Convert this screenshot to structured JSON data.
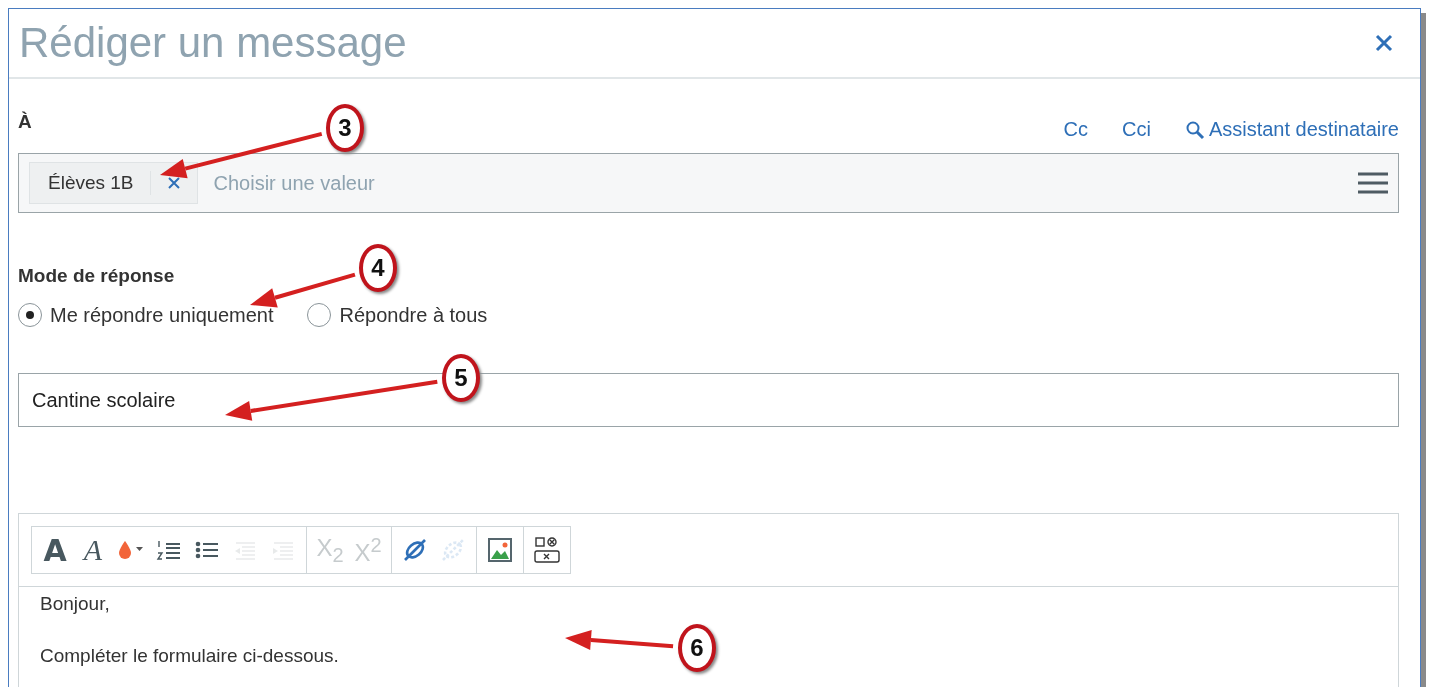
{
  "dialog": {
    "title": "Rédiger un message"
  },
  "recipients": {
    "label": "À",
    "links": [
      {
        "label": "Cc",
        "kind": "plain"
      },
      {
        "label": "Cci",
        "kind": "plain"
      },
      {
        "label": "Assistant destinataire",
        "kind": "search"
      }
    ],
    "chips": [
      {
        "label": "Élèves 1B"
      }
    ],
    "placeholder": "Choisir une valeur"
  },
  "reply_mode": {
    "label": "Mode de réponse",
    "options": [
      {
        "label": "Me répondre uniquement",
        "selected": true
      },
      {
        "label": "Répondre à tous",
        "selected": false
      }
    ]
  },
  "subject": {
    "value": "Cantine scolaire"
  },
  "editor": {
    "toolbar": [
      [
        {
          "kind": "bold",
          "label": "A",
          "disabled": false
        },
        {
          "kind": "italic",
          "label": "A",
          "disabled": false
        },
        {
          "kind": "color",
          "disabled": false
        },
        {
          "kind": "ordered-list",
          "disabled": false
        },
        {
          "kind": "bullet-list",
          "disabled": false
        },
        {
          "kind": "outdent",
          "disabled": true
        },
        {
          "kind": "indent",
          "disabled": true
        }
      ],
      [
        {
          "kind": "subscript",
          "label": "X$_{2}$",
          "disabled": true
        },
        {
          "kind": "superscript",
          "label": "X$^{2}$",
          "disabled": true
        }
      ],
      [
        {
          "kind": "link",
          "disabled": false
        },
        {
          "kind": "unlink",
          "disabled": true
        }
      ],
      [
        {
          "kind": "image",
          "disabled": false
        }
      ],
      [
        {
          "kind": "field",
          "disabled": false
        }
      ]
    ],
    "paragraphs": [
      "Bonjour,",
      "Compléter le formulaire ci-dessous."
    ]
  },
  "callouts": [
    {
      "number": "3"
    },
    {
      "number": "4"
    },
    {
      "number": "5"
    },
    {
      "number": "6"
    }
  ]
}
